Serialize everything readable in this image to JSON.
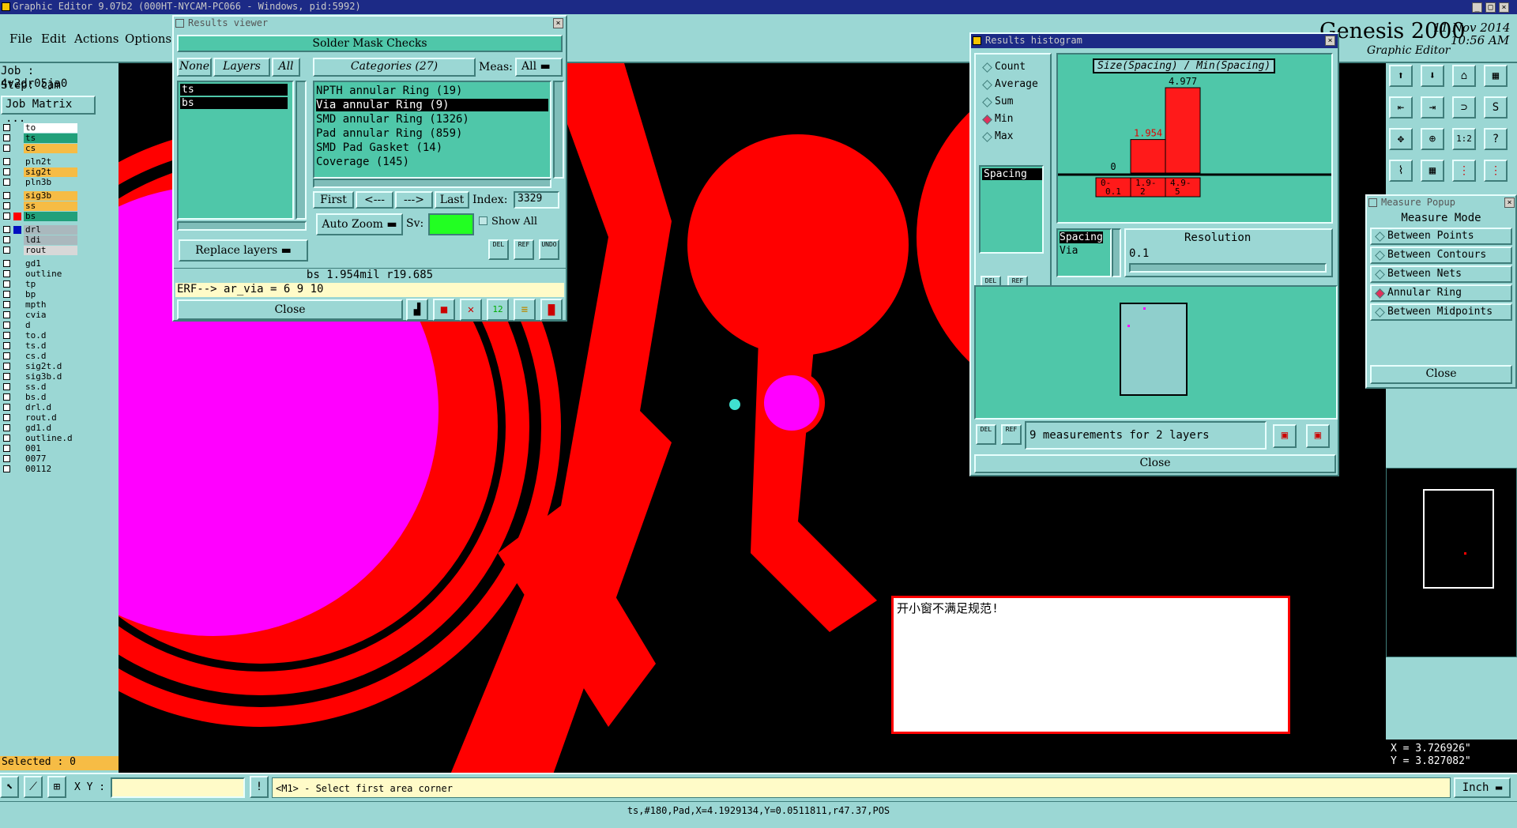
{
  "window": {
    "title": "Graphic Editor 9.07b2 (000HT-NYCAM-PC066 - Windows, pid:5992)",
    "brand_title": "Genesis 2000",
    "brand_sub": "Graphic Editor",
    "date": "11 Nov 2014",
    "time": "10:56 AM"
  },
  "menu": [
    "File",
    "Edit",
    "Actions",
    "Options"
  ],
  "job": {
    "job_label": "Job : 4v2dr05ja0",
    "step_label": "Step: cam",
    "matrix_button": "Job Matrix ..."
  },
  "layers": [
    {
      "name": "to",
      "color": "#ffffff"
    },
    {
      "name": "ts",
      "color": "#21a07a"
    },
    {
      "name": "cs",
      "color": "#f6bc45"
    },
    {
      "name": "pln2t",
      "color": "#9bd7d4"
    },
    {
      "name": "sig2t",
      "color": "#f6bc45"
    },
    {
      "name": "pln3b",
      "color": "#9bd7d4"
    },
    {
      "name": "sig3b",
      "color": "#f6bc45"
    },
    {
      "name": "ss",
      "color": "#f6bc45"
    },
    {
      "name": "bs",
      "color": "#21a07a"
    },
    {
      "name": "drl",
      "color": "#aab8bd"
    },
    {
      "name": "ldi",
      "color": "#aab8bd"
    },
    {
      "name": "rout",
      "color": "#d8d8d8"
    },
    {
      "name": "gd1",
      "color": "#9bd7d4"
    },
    {
      "name": "outline",
      "color": "#9bd7d4"
    },
    {
      "name": "tp",
      "color": "#9bd7d4"
    },
    {
      "name": "bp",
      "color": "#9bd7d4"
    },
    {
      "name": "mpth",
      "color": "#9bd7d4"
    },
    {
      "name": "cvia",
      "color": "#9bd7d4"
    },
    {
      "name": "d",
      "color": "#9bd7d4"
    },
    {
      "name": "to.d",
      "color": "#9bd7d4"
    },
    {
      "name": "ts.d",
      "color": "#9bd7d4"
    },
    {
      "name": "cs.d",
      "color": "#9bd7d4"
    },
    {
      "name": "sig2t.d",
      "color": "#9bd7d4"
    },
    {
      "name": "sig3b.d",
      "color": "#9bd7d4"
    },
    {
      "name": "ss.d",
      "color": "#9bd7d4"
    },
    {
      "name": "bs.d",
      "color": "#9bd7d4"
    },
    {
      "name": "drl.d",
      "color": "#9bd7d4"
    },
    {
      "name": "rout.d",
      "color": "#9bd7d4"
    },
    {
      "name": "gd1.d",
      "color": "#9bd7d4"
    },
    {
      "name": "outline.d",
      "color": "#9bd7d4"
    },
    {
      "name": "001",
      "color": "#9bd7d4"
    },
    {
      "name": "0077",
      "color": "#9bd7d4"
    },
    {
      "name": "00112",
      "color": "#9bd7d4"
    }
  ],
  "selected_label": "Selected : 0",
  "results_viewer": {
    "title": "Results viewer",
    "header": "Solder Mask Checks",
    "btn_none": "None",
    "btn_layers": "Layers",
    "btn_all": "All",
    "categories_label": "Categories (27)",
    "meas_label": "Meas:",
    "meas_value": "All",
    "layers": [
      "ts",
      "bs"
    ],
    "categories": [
      "NPTH annular Ring (19)",
      "Via annular Ring (9)",
      "SMD annular Ring (1326)",
      "Pad annular Ring (859)",
      "SMD Pad Gasket (14)",
      "Coverage (145)"
    ],
    "nav_first": "First",
    "nav_prev": "<---",
    "nav_next": "--->",
    "nav_last": "Last",
    "index_label": "Index:",
    "index_value": "3329",
    "auto_zoom": "Auto Zoom",
    "sv_label": "Sv:",
    "show_all": "Show All",
    "replace_layers": "Replace layers",
    "del": "DEL",
    "ref": "REF",
    "undo": "UNDO",
    "status": "bs 1.954mil  r19.685",
    "erf": "ERF--> ar_via = 6 9 10",
    "close": "Close"
  },
  "histogram": {
    "title": "Results histogram",
    "options": [
      "Count",
      "Average",
      "Sum",
      "Min",
      "Max"
    ],
    "selected_option": "Min",
    "list_item": "Spacing",
    "chart_title": "Size(Spacing) / Min(Spacing)",
    "spacing_label": "Spacing",
    "via_label": "Via",
    "resolution_label": "Resolution",
    "resolution_value": "0.1",
    "measurements": "9 measurements for 2 layers",
    "close": "Close",
    "del": "DEL",
    "ref": "REF"
  },
  "chart_data": {
    "type": "bar",
    "title": "Size(Spacing) / Min(Spacing)",
    "categories": [
      "0-\n0.1",
      "1.9-\n2",
      "4.9-\n5"
    ],
    "values": [
      0,
      1.954,
      4.977
    ],
    "value_labels": [
      "0",
      "1.954",
      "4.977"
    ],
    "label_colors": [
      "#000000",
      "#e00000",
      "#000000"
    ],
    "bar_color": "#ff1a1a",
    "ylim": [
      0,
      4.977
    ],
    "grid": false
  },
  "measure_popup": {
    "title": "Measure Popup",
    "header": "Measure Mode",
    "modes": [
      "Between Points",
      "Between Contours",
      "Between Nets",
      "Annular Ring",
      "Between Midpoints"
    ],
    "selected_mode": "Annular Ring",
    "close": "Close"
  },
  "message_box": {
    "text": "开小窗不满足规范!"
  },
  "coords": {
    "x": "X = 3.726926\"",
    "y": "Y = 3.827082\""
  },
  "bottom_bar": {
    "xy_label": "X Y :",
    "xy_value": "",
    "prompt": "<M1> - Select first area corner",
    "units": "Inch"
  },
  "status_line": "ts,#180,Pad,X=4.1929134,Y=0.0511811,r47.37,POS",
  "colors": {
    "teal": "#9bd7d4",
    "green_list": "#4fc7a9",
    "title_bar": "#1c2a86",
    "red_feature": "#ff0000",
    "magenta_feature": "#ff00ff"
  }
}
